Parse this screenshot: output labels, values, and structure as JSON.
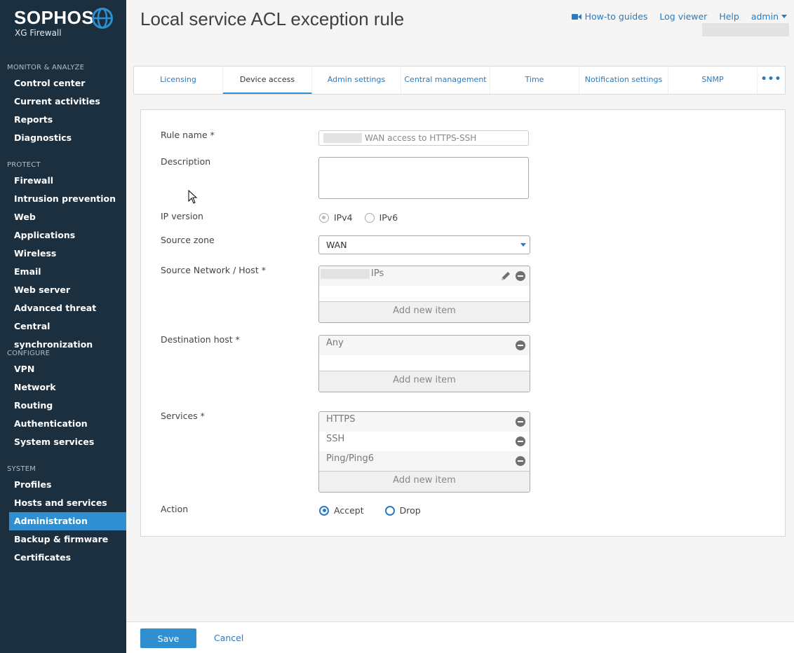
{
  "brand": {
    "name": "SOPHOS",
    "product": "XG Firewall"
  },
  "sidebar": {
    "sections": [
      {
        "title": "MONITOR & ANALYZE",
        "items": [
          "Control center",
          "Current activities",
          "Reports",
          "Diagnostics"
        ]
      },
      {
        "title": "PROTECT",
        "items": [
          "Firewall",
          "Intrusion prevention",
          "Web",
          "Applications",
          "Wireless",
          "Email",
          "Web server",
          "Advanced threat",
          "Central synchronization"
        ]
      },
      {
        "title": "CONFIGURE",
        "items": [
          "VPN",
          "Network",
          "Routing",
          "Authentication",
          "System services"
        ]
      },
      {
        "title": "SYSTEM",
        "items": [
          "Profiles",
          "Hosts and services",
          "Administration",
          "Backup & firmware",
          "Certificates"
        ]
      }
    ],
    "active_item": "Administration"
  },
  "header": {
    "title": "Local service ACL exception rule",
    "links": {
      "guides": "How-to guides",
      "log_viewer": "Log viewer",
      "help": "Help",
      "user": "admin"
    }
  },
  "tabs": [
    "Licensing",
    "Device access",
    "Admin settings",
    "Central management",
    "Time",
    "Notification settings",
    "SNMP"
  ],
  "active_tab": "Device access",
  "tab_more": "•••",
  "form": {
    "rule_name": {
      "label": "Rule name *",
      "value": "WAN access to HTTPS-SSH"
    },
    "description": {
      "label": "Description",
      "value": ""
    },
    "ip_version": {
      "label": "IP version",
      "options": [
        "IPv4",
        "IPv6"
      ],
      "selected": "IPv4"
    },
    "source_zone": {
      "label": "Source zone",
      "value": "WAN"
    },
    "source_network": {
      "label": "Source Network / Host *",
      "items": [
        "IPs"
      ],
      "add_label": "Add new item"
    },
    "destination_host": {
      "label": "Destination host *",
      "items": [
        "Any"
      ],
      "add_label": "Add new item"
    },
    "services": {
      "label": "Services *",
      "items": [
        "HTTPS",
        "SSH",
        "Ping/Ping6"
      ],
      "add_label": "Add new item"
    },
    "action": {
      "label": "Action",
      "options": [
        "Accept",
        "Drop"
      ],
      "selected": "Accept"
    }
  },
  "footer": {
    "save_label": "Save",
    "cancel_label": "Cancel"
  },
  "colors": {
    "sidebar_bg": "#1b2f3f",
    "accent": "#2f8fd0",
    "link": "#2a7ac0"
  }
}
